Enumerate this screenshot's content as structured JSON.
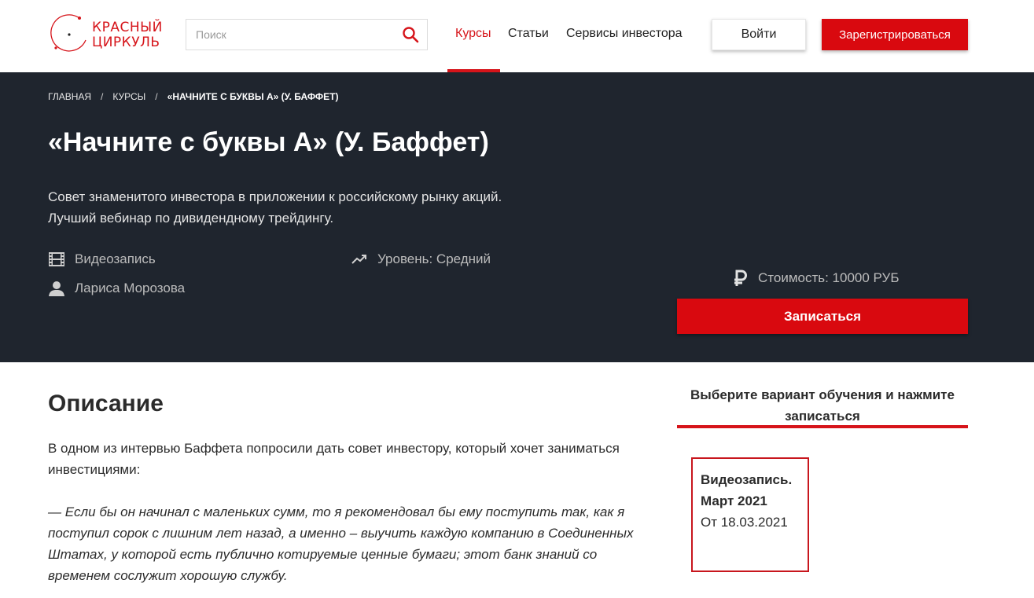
{
  "header": {
    "logo": {
      "line1": "КРАСНЫЙ",
      "line2": "ЦИРКУЛЬ"
    },
    "search": {
      "placeholder": "Поиск",
      "value": ""
    },
    "nav": [
      {
        "label": "Курсы",
        "active": true
      },
      {
        "label": "Статьи",
        "active": false
      },
      {
        "label": "Сервисы инвестора",
        "active": false
      }
    ],
    "login_label": "Войти",
    "register_label": "Зарегистрироваться"
  },
  "hero": {
    "breadcrumb": [
      "ГЛАВНАЯ",
      "КУРСЫ",
      "«НАЧНИТЕ С БУКВЫ А» (У. БАФФЕТ)"
    ],
    "breadcrumb_sep": "/",
    "title": "«Начните с буквы А» (У. Баффет)",
    "description": "Совет знаменитого инвестора в приложении к российскому рынку акций. Лучший вебинар по дивидендному трейдингу.",
    "format": "Видеозапись",
    "level": "Уровень: Средний",
    "author": "Лариса Морозова",
    "price": "Стоимость: 10000 РУБ",
    "enroll_label": "Записаться"
  },
  "content": {
    "section_title": "Описание",
    "paragraph": "В одном из интервью Баффета попросили дать совет инвестору, который хочет заниматься инвестициями:",
    "quote": "— Если бы он начинал с маленьких сумм, то я рекомендовал бы ему поступить так, как я поступил сорок с лишним лет назад, а именно – выучить каждую компанию в Соединенных Штатах, у которой есть публично котируемые ценные бумаги; этот банк знаний со временем сослужит хорошую службу."
  },
  "aside": {
    "title": "Выберите вариант обучения и нажмите записаться",
    "option": {
      "line1": "Видеозапись.",
      "line2": "Март 2021",
      "line3": "От 18.03.2021"
    }
  },
  "colors": {
    "accent": "#d6141a",
    "hero_bg": "#1f252e"
  },
  "icons": {
    "search": "search-icon",
    "format": "film-icon",
    "level": "trending-up-icon",
    "author": "person-icon",
    "price": "ruble-icon",
    "logo": "compass-logo-icon"
  }
}
